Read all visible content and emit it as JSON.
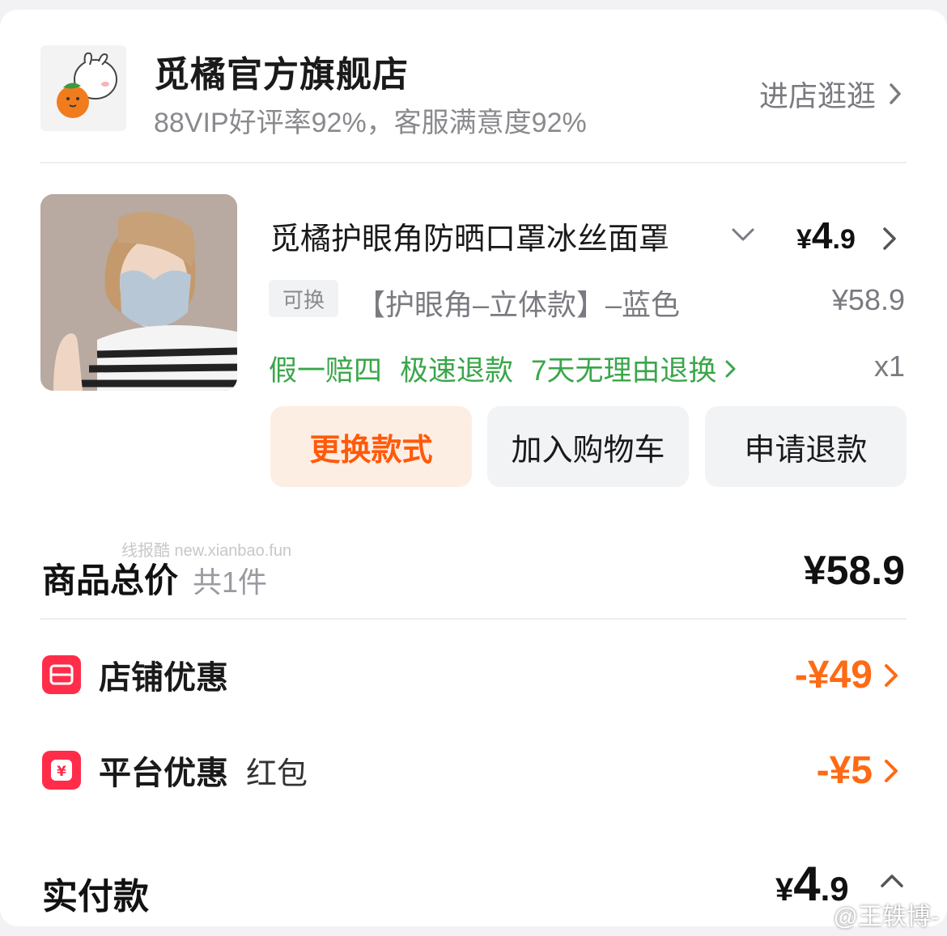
{
  "store": {
    "name": "觅橘官方旗舰店",
    "rating": "88VIP好评率92%，客服满意度92%",
    "enter_label": "进店逛逛"
  },
  "product": {
    "title": "觅橘护眼角防晒口罩冰丝面罩",
    "price_currency": "¥",
    "price_int": "4",
    "price_dec": ".9",
    "exchange_tag": "可换",
    "sku": "【护眼角–立体款】–蓝色",
    "original_price": "¥58.9",
    "services": [
      "假一赔四",
      "极速退款",
      "7天无理由退换"
    ],
    "quantity": "x1"
  },
  "buttons": {
    "change_style": "更换款式",
    "add_cart": "加入购物车",
    "refund": "申请退款"
  },
  "watermark": "线报酷 new.xianbao.fun",
  "totals": {
    "goods_label": "商品总价",
    "goods_count": "共1件",
    "goods_value": "¥58.9",
    "store_discount_label": "店铺优惠",
    "store_discount_value": "-¥49",
    "platform_discount_label": "平台优惠",
    "platform_discount_sub": "红包",
    "platform_discount_value": "-¥5",
    "pay_label": "实付款",
    "pay_currency": "¥",
    "pay_int": "4",
    "pay_dec": ".9"
  },
  "weibo_watermark": "@王轶博-",
  "colors": {
    "accent_orange": "#ff5a0a",
    "discount_orange": "#ff6a14",
    "service_green": "#3aa64a",
    "icon_red": "#ff2d4a"
  }
}
